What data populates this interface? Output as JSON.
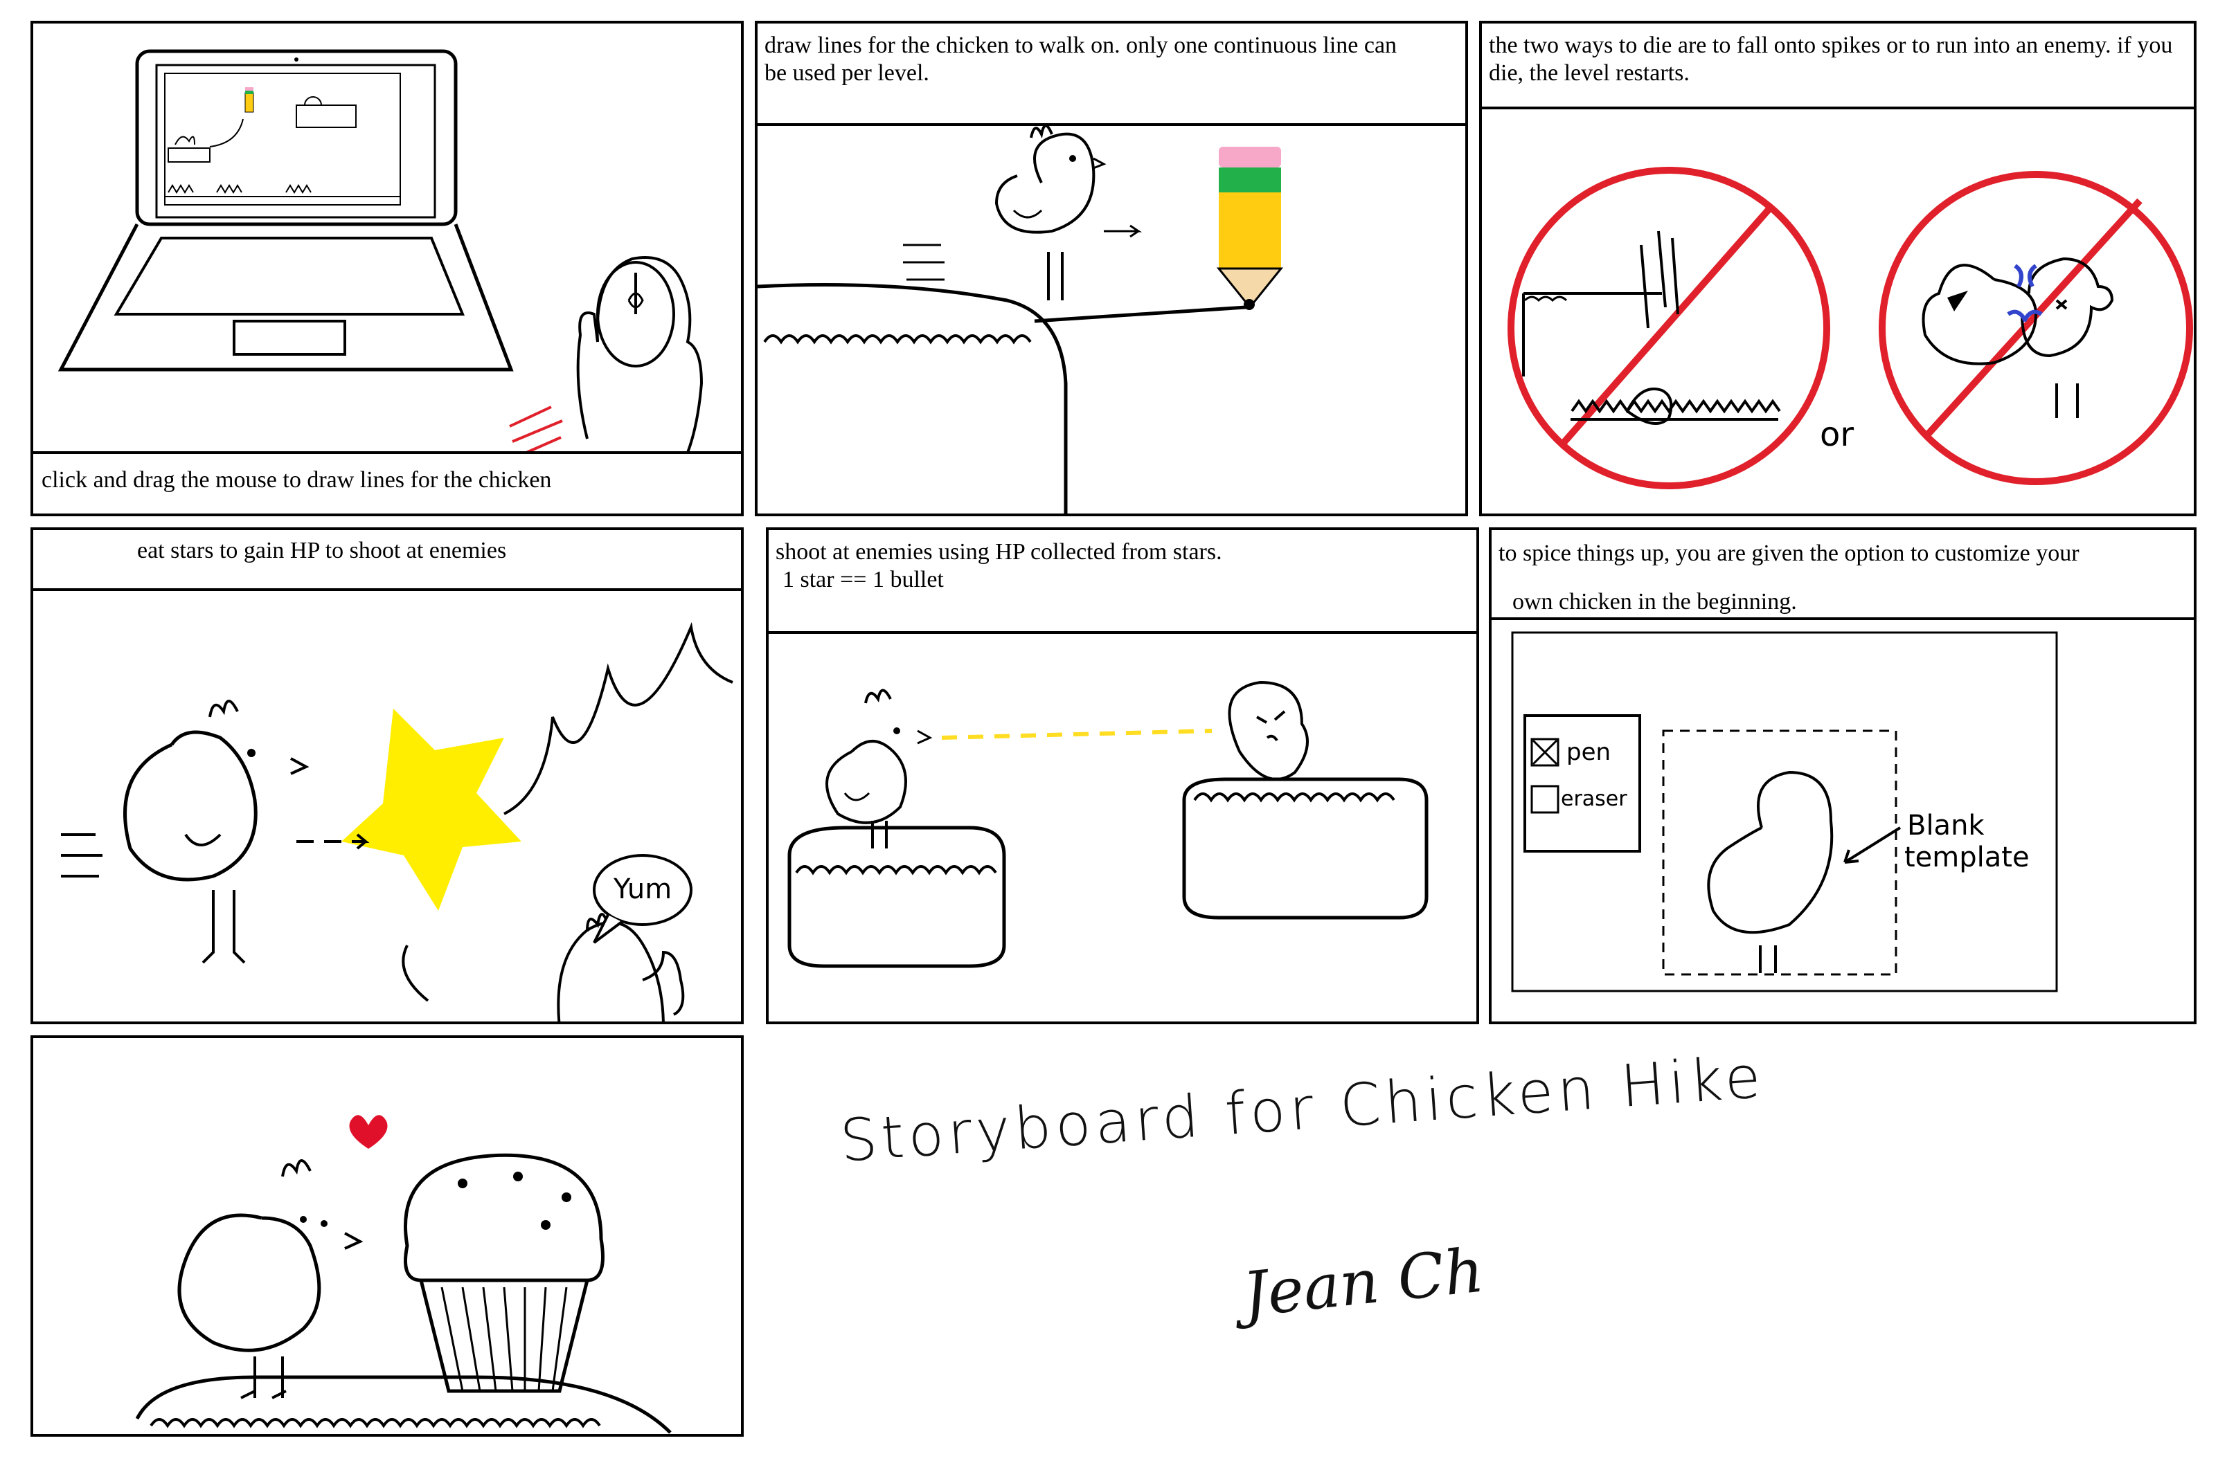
{
  "panels": {
    "p1": {
      "caption": "click and drag the mouse to draw lines for the chicken"
    },
    "p2": {
      "caption": "draw lines for the chicken to walk on. only one continuous line can be used per level."
    },
    "p3": {
      "caption": "the two ways to die are to fall onto spikes or to run into an enemy. if you die, the level restarts.",
      "or_label": "or"
    },
    "p4": {
      "caption": "eat stars to gain HP to shoot at enemies",
      "speech": "Yum"
    },
    "p5": {
      "caption_line1": "shoot at enemies using HP collected from stars.",
      "caption_line2": "1 star == 1 bullet"
    },
    "p6": {
      "caption_line1": "to spice things up, you are given the option to customize your",
      "caption_line2": "own chicken in the beginning.",
      "tools": [
        "pen",
        "eraser"
      ],
      "pointer_label_1": "Blank",
      "pointer_label_2": "template"
    }
  },
  "title": {
    "line1": "Storyboard for Chicken Hike",
    "signature": "Jean Ch"
  },
  "colors": {
    "ink": "#000000",
    "forbid_red": "#e0202a",
    "star_yellow": "#ffee00",
    "pencil_yellow": "#ffcc11",
    "pencil_green": "#22b04a",
    "pencil_pink": "#f7a8c8",
    "shot_yellow": "#ffdd22",
    "heart_red": "#e0102a",
    "bonk_blue": "#3344cc"
  }
}
